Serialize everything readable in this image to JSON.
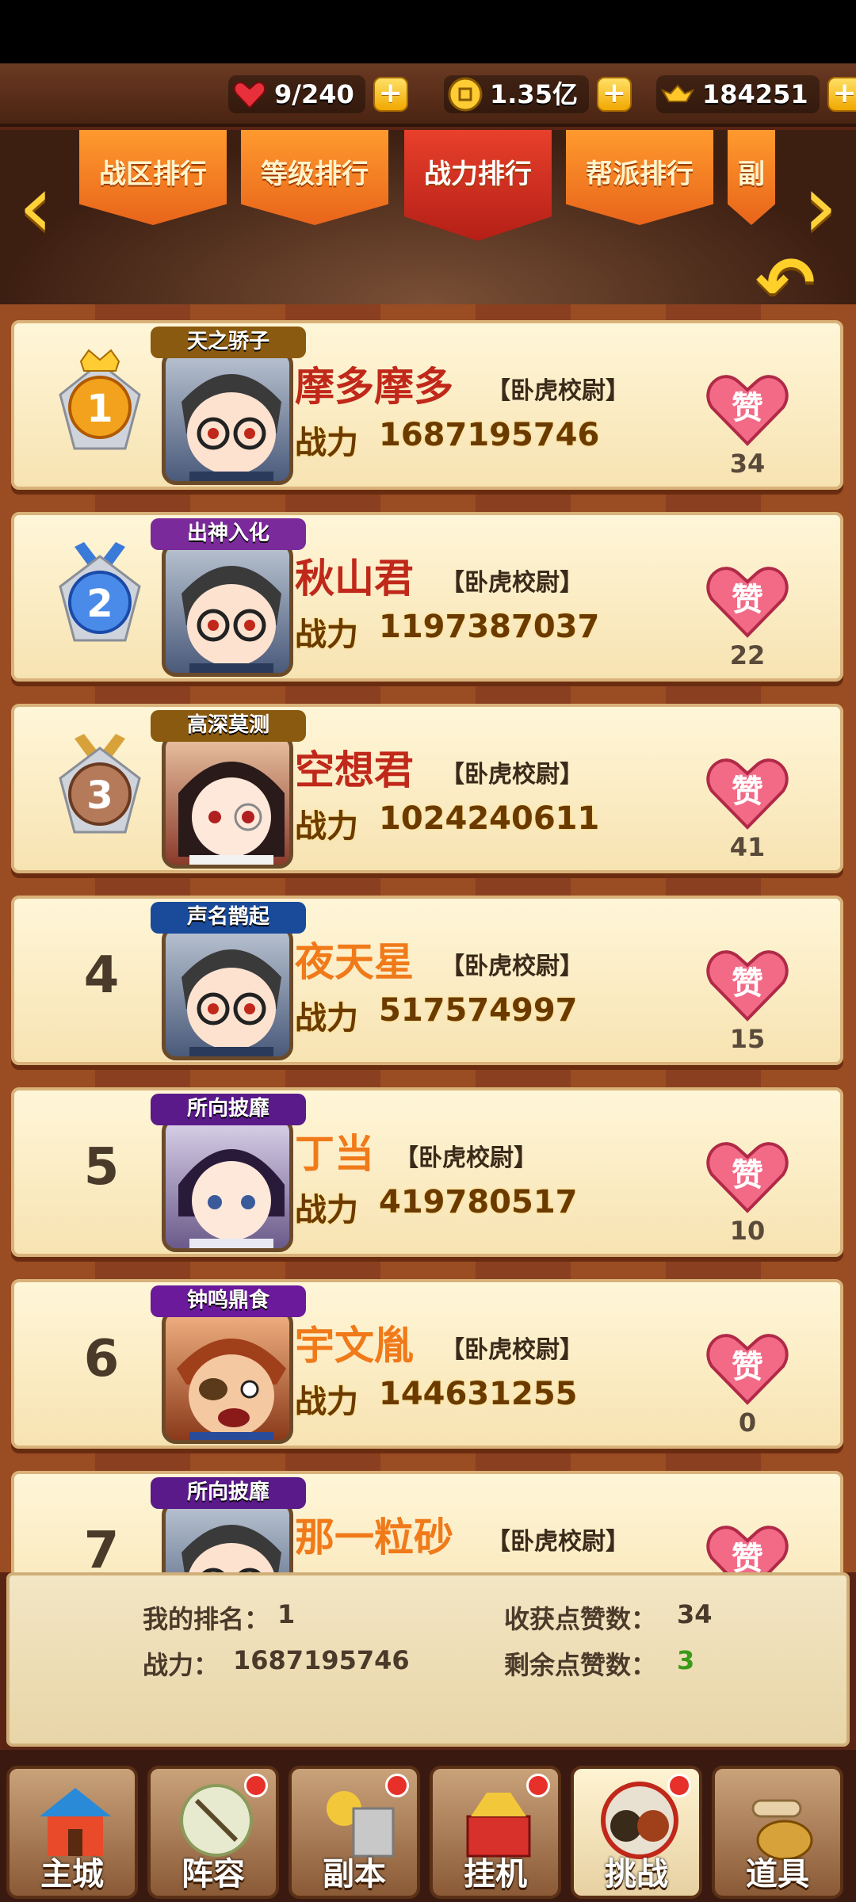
{
  "resources": {
    "stamina": "9/240",
    "coins": "1.35亿",
    "ingots": "184251"
  },
  "tabs": [
    {
      "label": "战区排行"
    },
    {
      "label": "等级排行"
    },
    {
      "label": "战力排行"
    },
    {
      "label": "帮派排行"
    },
    {
      "label": "副"
    }
  ],
  "power_label": "战力",
  "rankings": [
    {
      "rank": "1",
      "title_tag": "天之骄子",
      "name": "摩多摩多",
      "rank_title": "【卧虎校尉】",
      "power": "1687195746",
      "likes": "34",
      "name_color": "#c0281a",
      "tag_color": "#8a5a10"
    },
    {
      "rank": "2",
      "title_tag": "出神入化",
      "name": "秋山君",
      "rank_title": "【卧虎校尉】",
      "power": "1197387037",
      "likes": "22",
      "name_color": "#c0281a",
      "tag_color": "#7a2a9a"
    },
    {
      "rank": "3",
      "title_tag": "高深莫测",
      "name": "空想君",
      "rank_title": "【卧虎校尉】",
      "power": "1024240611",
      "likes": "41",
      "name_color": "#c0281a",
      "tag_color": "#8a5a10"
    },
    {
      "rank": "4",
      "title_tag": "声名鹊起",
      "name": "夜天星",
      "rank_title": "【卧虎校尉】",
      "power": "517574997",
      "likes": "15",
      "name_color": "#f07a1a",
      "tag_color": "#1a4a9a"
    },
    {
      "rank": "5",
      "title_tag": "所向披靡",
      "name": "丁当",
      "rank_title": "【卧虎校尉】",
      "power": "419780517",
      "likes": "10",
      "name_color": "#f07a1a",
      "tag_color": "#5a1a8a"
    },
    {
      "rank": "6",
      "title_tag": "钟鸣鼎食",
      "name": "宇文胤",
      "rank_title": "【卧虎校尉】",
      "power": "144631255",
      "likes": "0",
      "name_color": "#f07a1a",
      "tag_color": "#6a1a9a"
    },
    {
      "rank": "7",
      "title_tag": "所向披靡",
      "name": "那一粒砂",
      "rank_title": "【卧虎校尉】",
      "power": "",
      "likes": "",
      "name_color": "#f07a1a",
      "tag_color": "#5a1a8a"
    }
  ],
  "my_info": {
    "rank_label": "我的排名：",
    "rank_value": "1",
    "power_label": "战力：",
    "power_value": "1687195746",
    "received_label": "收获点赞数：",
    "received_value": "34",
    "remaining_label": "剩余点赞数：",
    "remaining_value": "3"
  },
  "like_char": "赞",
  "nav": [
    {
      "label": "主城",
      "badge": false
    },
    {
      "label": "阵容",
      "badge": true
    },
    {
      "label": "副本",
      "badge": true
    },
    {
      "label": "挂机",
      "badge": true
    },
    {
      "label": "挑战",
      "badge": true
    },
    {
      "label": "道具",
      "badge": false
    }
  ]
}
